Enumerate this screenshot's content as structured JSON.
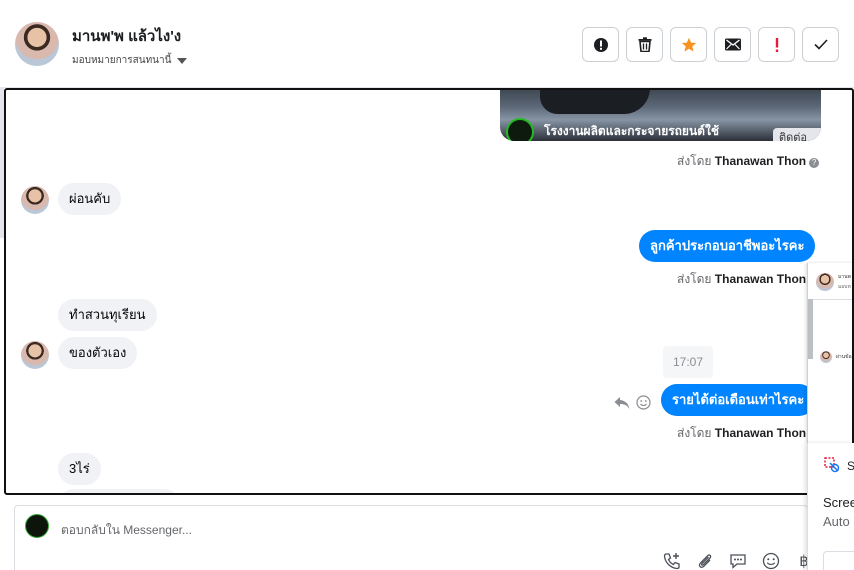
{
  "header": {
    "contact_name": "มานพ'พ แล้วไง'ง",
    "assign_label": "มอบหมายการสนทนานี้",
    "actions": [
      {
        "icon": "alert-circle-icon",
        "color": "#1c1e21"
      },
      {
        "icon": "trash-icon",
        "color": "#1c1e21"
      },
      {
        "icon": "star-icon",
        "color": "#f7931e"
      },
      {
        "icon": "envelope-icon",
        "color": "#1c1e21"
      },
      {
        "icon": "exclamation-icon",
        "color": "#e41e3f"
      },
      {
        "icon": "check-icon",
        "color": "#1c1e21"
      }
    ]
  },
  "chat": {
    "image_card": {
      "caption": "โรงงานผลิตและกระจายรถยนต์ใช้",
      "cta_label": "ติดต่อ"
    },
    "sent_by_prefix": "ส่งโดย",
    "agent_name": "Thanawan Thon",
    "messages": {
      "in_1": "ผ่อนคับ",
      "out_1": "ลูกค้าประกอบอาชีพอะไรคะ",
      "in_2": "ทำสวนทุเรียน",
      "in_3": "ของตัวเอง",
      "timestamp": "17:07",
      "out_2": "รายได้ต่อเดือนเท่าไรคะ",
      "in_4": "3ไร่"
    },
    "mini_window": {
      "name_snippet": "มานพ",
      "sub_snippet": "มอบห",
      "item_snippet": "ผ่านข้อ"
    }
  },
  "composer": {
    "placeholder": "ตอบกลับใน Messenger...",
    "tools": [
      "phone-add-icon",
      "paperclip-icon",
      "chat-bubble-icon",
      "emoji-icon",
      "baht-icon"
    ]
  },
  "side_panel": {
    "title_letter": "S",
    "line1": "Scree",
    "line2": "Auto"
  },
  "colors": {
    "accent": "#0084ff",
    "incoming_bubble": "#f0f2f5",
    "star": "#f7931e",
    "alert_red": "#e41e3f"
  }
}
